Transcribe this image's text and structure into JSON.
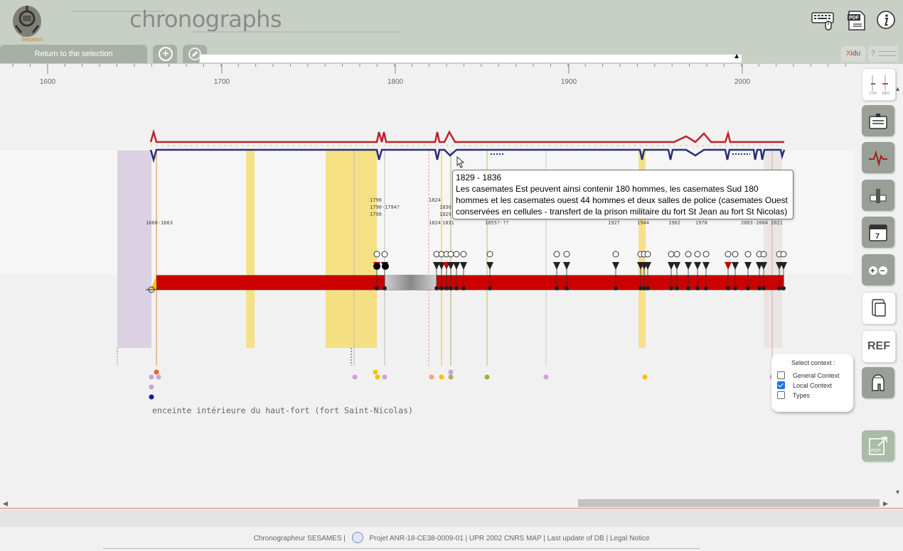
{
  "header": {
    "app_title": "chronographs",
    "logo_text": "Sesames",
    "icons": [
      "keyboard-mouse-icon",
      "pdf-icon",
      "info-icon"
    ],
    "pdf_badge": "PDF"
  },
  "tabs": {
    "return_label": "Return to the selection",
    "add_icon": "plus-circle-icon",
    "edit_icon": "pencil-icon",
    "xidu_x": "X",
    "xidu_label": "idu",
    "help_label": "?"
  },
  "ruler": {
    "labels": [
      "1600",
      "1700",
      "1800",
      "1900",
      "2000"
    ]
  },
  "timeline": {
    "range_labels": [
      "1660-1663",
      "1790",
      "1790-1794?",
      "1790",
      "1824",
      "1830",
      "1829",
      "1824",
      "1831",
      "1855?-??",
      "1927",
      "1944",
      "1962",
      "1978",
      "2003-2004",
      "2021"
    ],
    "entity_name": "enceinte intérieure du haut-fort (fort Saint-Nicolas)"
  },
  "tooltip": {
    "range": "1829 - 1836",
    "text": "Les casemates Est peuvent ainsi contenir 180 hommes, les casemates Sud 180 hommes et les casemates ouest 44 hommes et deux salles de police (casemates Ouest conservées en cellules - transfert de la prison militaire du fort St Jean au fort St Nicolas)"
  },
  "sidebar": {
    "ref_label": "REF",
    "calendar_day": "7",
    "pdf_badge": "PDF",
    "zoom_plus": "+",
    "zoom_minus": "−"
  },
  "context": {
    "title": "Select context :",
    "options": [
      {
        "label": "General Context",
        "checked": false
      },
      {
        "label": "Local Context",
        "checked": true
      },
      {
        "label": "Types",
        "checked": false
      }
    ]
  },
  "footer": {
    "chronographer": "Chronographeur SESAMES",
    "project": "Projet ANR-18-CE38-0009-01",
    "lab": "UPR 2002 CNRS MAP",
    "last_update": "Last update of DB",
    "legal": "Legal Notice"
  },
  "colors": {
    "header_bg": "#c8d0c6",
    "bar_red": "#cc0000",
    "line_red": "#c0202a",
    "line_blue": "#2a2f7a",
    "yellow": "#f5dc70",
    "lilac": "#d8cde0"
  }
}
